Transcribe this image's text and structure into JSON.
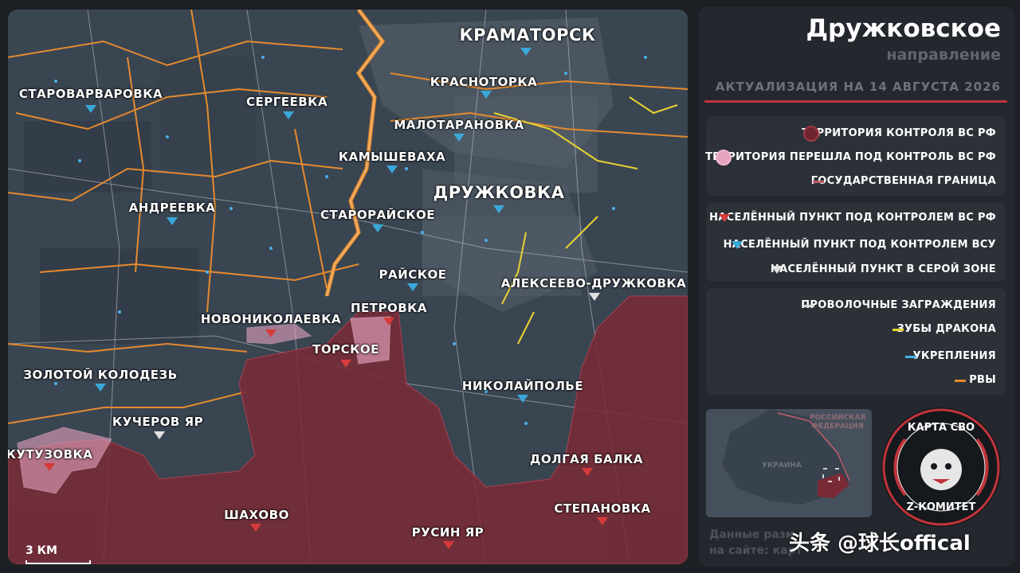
{
  "header": {
    "title": "Дружковское",
    "subtitle": "направление",
    "updated": "АКТУАЛИЗАЦИЯ НА 14 АВГУСТА 2026"
  },
  "legend": {
    "territory": [
      {
        "label": "ТЕРРИТОРИЯ КОНТРОЛЯ ВС РФ",
        "color": "#6e2530"
      },
      {
        "label": "ТЕРРИТОРИЯ ПЕРЕШЛА ПОД КОНТРОЛЬ ВС РФ",
        "color": "#e6a3c0"
      },
      {
        "label": "ГОСУДАРСТВЕННАЯ ГРАНИЦА",
        "color": "#c0606c"
      }
    ],
    "settlements": [
      {
        "label": "НАСЕЛЁННЫЙ ПУНКТ ПОД КОНТРОЛЕМ ВС РФ",
        "color": "#d63a3a"
      },
      {
        "label": "НАСЕЛЁННЫЙ ПУНКТ ПОД КОНТРОЛЕМ ВСУ",
        "color": "#3aa8d8"
      },
      {
        "label": "НАСЕЛЁННЫЙ ПУНКТ В СЕРОЙ ЗОНЕ",
        "color": "#e0e0e0"
      }
    ],
    "fortifications": [
      {
        "label": "ПРОВОЛОЧНЫЕ ЗАГРАЖДЕНИЯ",
        "color": "#d8d8d8"
      },
      {
        "label": "ЗУБЫ ДРАКОНА",
        "color": "#e8d230"
      },
      {
        "label": "УКРЕПЛЕНИЯ",
        "color": "#4ab0e8"
      },
      {
        "label": "РВЫ",
        "color": "#e68a2e"
      }
    ]
  },
  "map": {
    "scale": "3 КМ",
    "places": [
      {
        "name": "КРАМАТОРСК",
        "ctrl": "ua",
        "big": true
      },
      {
        "name": "СТАРОВАРВАРОВКА",
        "ctrl": "ua"
      },
      {
        "name": "СЕРГЕЕВКА",
        "ctrl": "ua"
      },
      {
        "name": "КРАСНОТОРКА",
        "ctrl": "ua"
      },
      {
        "name": "МАЛОТАРАНОВКА",
        "ctrl": "ua"
      },
      {
        "name": "КАМЫШЕВАХА",
        "ctrl": "ua"
      },
      {
        "name": "ДРУЖКОВКА",
        "ctrl": "ua",
        "big": true
      },
      {
        "name": "АНДРЕЕВКА",
        "ctrl": "ua"
      },
      {
        "name": "СТАРОРАЙСКОЕ",
        "ctrl": "ua"
      },
      {
        "name": "РАЙСКОЕ",
        "ctrl": "ua"
      },
      {
        "name": "АЛЕКСЕЕВО-ДРУЖКОВКА",
        "ctrl": "gray"
      },
      {
        "name": "ПЕТРОВКА",
        "ctrl": "ru"
      },
      {
        "name": "НОВОНИКОЛАЕВКА",
        "ctrl": "ru"
      },
      {
        "name": "ТОРСКОЕ",
        "ctrl": "ru"
      },
      {
        "name": "ЗОЛОТОЙ КОЛОДЕЗЬ",
        "ctrl": "ua"
      },
      {
        "name": "НИКОЛАЙПОЛЬЕ",
        "ctrl": "ua"
      },
      {
        "name": "КУЧЕРОВ ЯР",
        "ctrl": "gray"
      },
      {
        "name": "КУТУЗОВКА",
        "ctrl": "ru"
      },
      {
        "name": "ДОЛГАЯ БАЛКА",
        "ctrl": "ru"
      },
      {
        "name": "ШАХОВО",
        "ctrl": "ru"
      },
      {
        "name": "СТЕПАНОВКА",
        "ctrl": "ru"
      },
      {
        "name": "РУСИН ЯР",
        "ctrl": "ru"
      }
    ]
  },
  "inset": {
    "label_ru": "РОССИЙСКАЯ ФЕДЕРАЦИЯ",
    "label_ua": "УКРАИНА"
  },
  "logo": {
    "top": "КАРТА СВО",
    "bottom": "Z-КОМИТЕТ"
  },
  "footer": {
    "line1": "Данные разм",
    "line2": "на сайте: карт",
    "watermark": "头条 @球长offical"
  }
}
